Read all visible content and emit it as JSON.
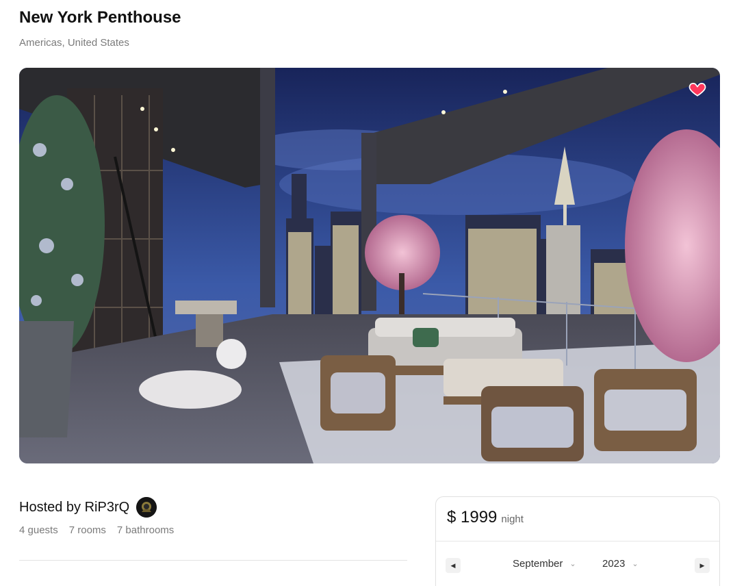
{
  "listing": {
    "title": "New York Penthouse",
    "location": "Americas, United States",
    "favorited": true
  },
  "host": {
    "label": "Hosted by RiP3rQ"
  },
  "stats": {
    "guests": "4 guests",
    "rooms": "7 rooms",
    "bathrooms": "7 bathrooms"
  },
  "booking": {
    "price": "$ 1999",
    "unit": "night",
    "calendar": {
      "month": "September",
      "year": "2023"
    }
  },
  "colors": {
    "heart": "#ff385c",
    "sky_top": "#1b2660",
    "sky_bottom": "#3d5aa6"
  },
  "icons": {
    "favorite": "heart-icon",
    "prev": "caret-left-icon",
    "next": "caret-right-icon",
    "dropdown": "chevron-down-icon"
  }
}
